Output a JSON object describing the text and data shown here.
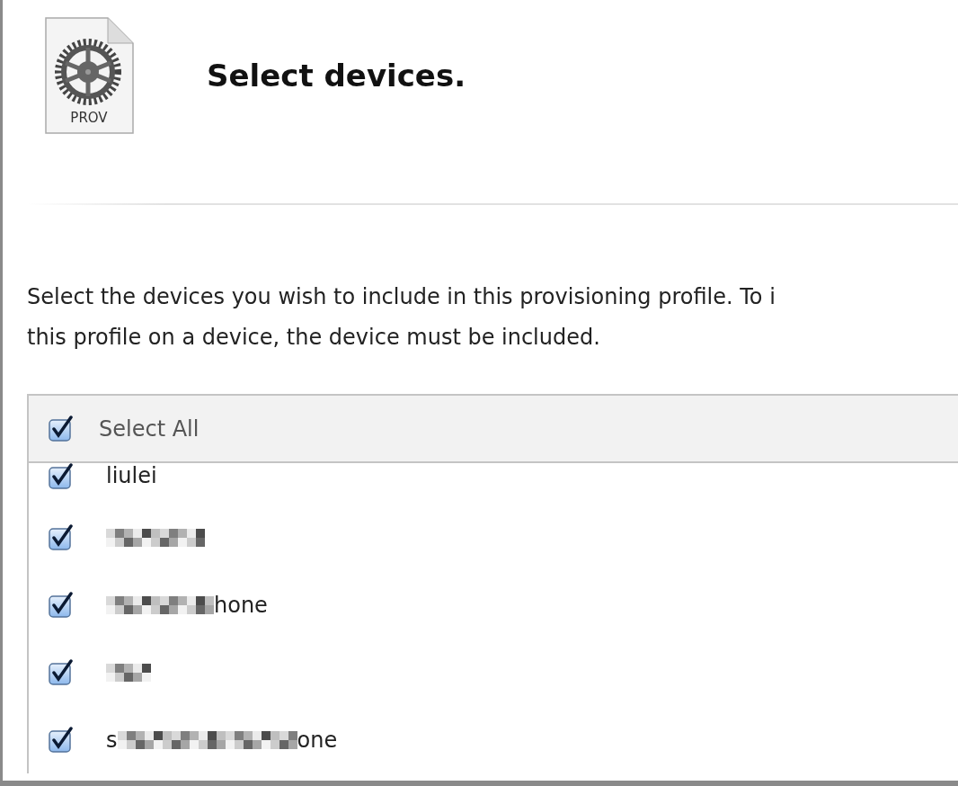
{
  "header": {
    "icon_label": "PROV",
    "title": "Select devices."
  },
  "description": {
    "lines": [
      "Select the devices you wish to include in this provisioning profile. To i",
      "this profile on a device, the device must be included."
    ]
  },
  "device_list": {
    "select_all": {
      "label": "Select All",
      "checked": true
    },
    "devices": [
      {
        "checked": true,
        "parts": [
          {
            "kind": "text",
            "text": "liulei"
          }
        ]
      },
      {
        "checked": true,
        "parts": [
          {
            "kind": "blur_medium"
          }
        ]
      },
      {
        "checked": true,
        "parts": [
          {
            "kind": "blur_long"
          },
          {
            "kind": "text",
            "text": "hone"
          }
        ]
      },
      {
        "checked": true,
        "parts": [
          {
            "kind": "blur_short"
          }
        ]
      },
      {
        "checked": true,
        "parts": [
          {
            "kind": "text",
            "text": "s"
          },
          {
            "kind": "blur_extra"
          },
          {
            "kind": "text",
            "text": "one"
          }
        ]
      }
    ]
  }
}
